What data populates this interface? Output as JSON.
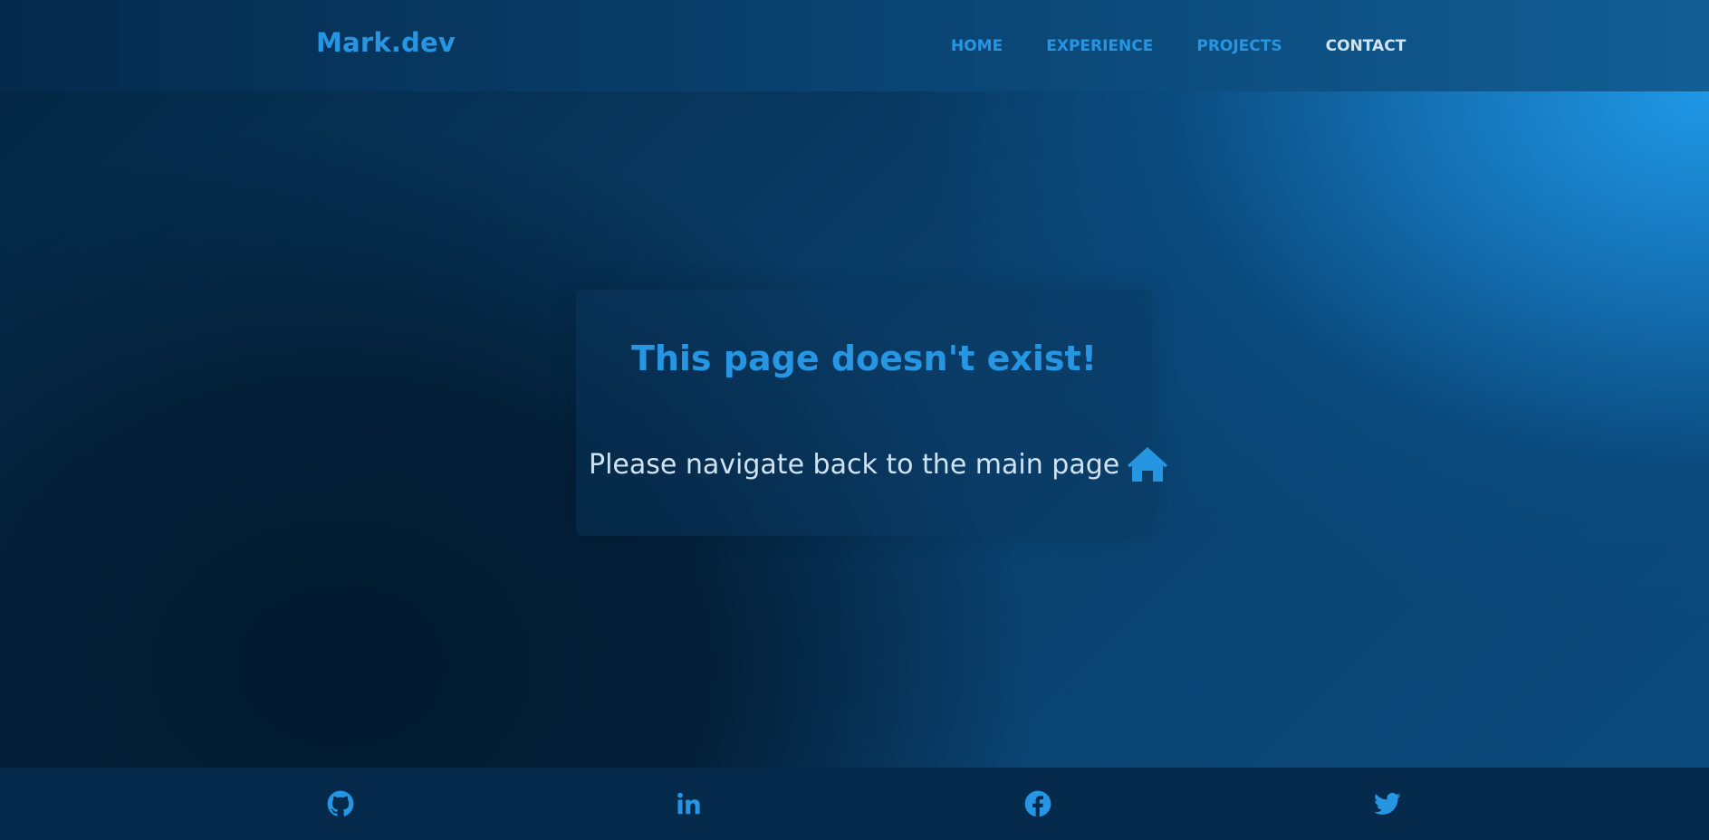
{
  "header": {
    "brand": "Mark.dev",
    "nav": [
      {
        "label": "HOME"
      },
      {
        "label": "EXPERIENCE"
      },
      {
        "label": "PROJECTS"
      },
      {
        "label": "CONTACT"
      }
    ]
  },
  "main": {
    "title": "This page doesn't exist!",
    "message": "Please navigate back to the main page",
    "home_icon": "home-icon"
  },
  "footer": {
    "social_icons": [
      "github-icon",
      "linkedin-icon",
      "facebook-icon",
      "twitter-icon"
    ]
  },
  "colors": {
    "accent": "#2796e2",
    "text_light": "#cfe3f3",
    "header_bg": "#052a4c",
    "footer_bg": "#052a4c"
  }
}
